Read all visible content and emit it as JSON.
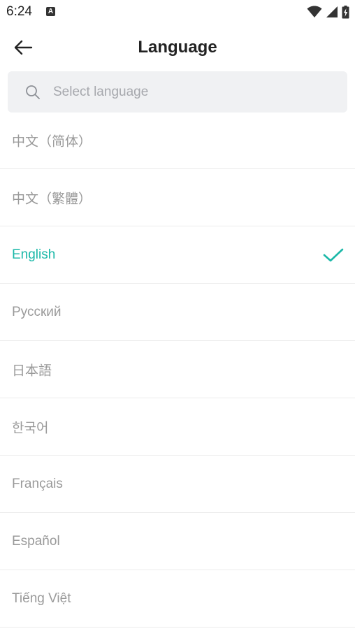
{
  "status_bar": {
    "time": "6:24",
    "notification_icon": "a-icon",
    "icons": [
      "wifi-icon",
      "signal-icon",
      "battery-charging-icon"
    ]
  },
  "header": {
    "title": "Language",
    "back_icon": "arrow-left-icon"
  },
  "search": {
    "placeholder": "Select language",
    "value": ""
  },
  "languages": [
    {
      "label": "中文（简体）",
      "selected": false
    },
    {
      "label": "中文（繁體）",
      "selected": false
    },
    {
      "label": "English",
      "selected": true
    },
    {
      "label": "Русский",
      "selected": false
    },
    {
      "label": "日本語",
      "selected": false
    },
    {
      "label": "한국어",
      "selected": false
    },
    {
      "label": "Français",
      "selected": false
    },
    {
      "label": "Español",
      "selected": false
    },
    {
      "label": "Tiếng Việt",
      "selected": false
    }
  ],
  "colors": {
    "accent": "#1bb8a8",
    "text_muted": "#9a9a9a",
    "search_bg": "#f0f1f3"
  }
}
